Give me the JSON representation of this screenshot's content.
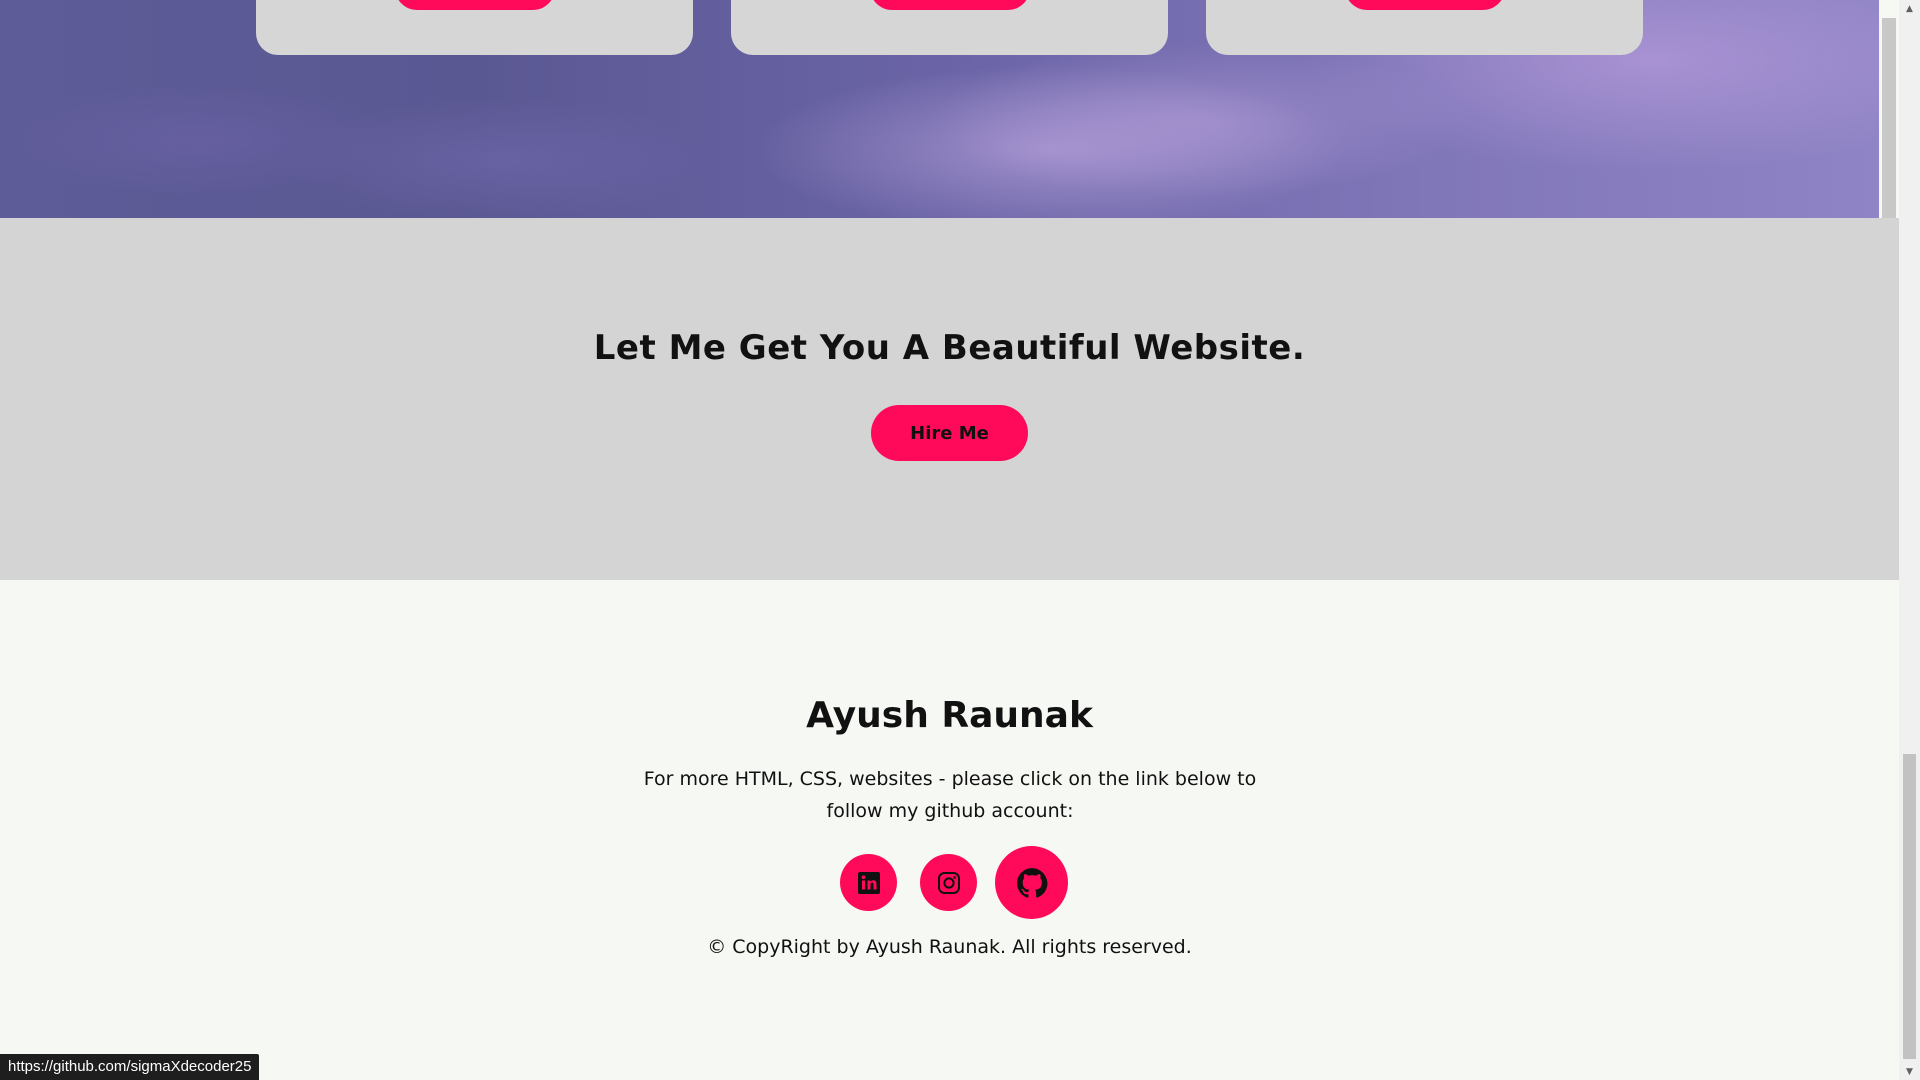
{
  "hero": {
    "cards": [
      {
        "name": "service-card-1"
      },
      {
        "name": "service-card-2"
      },
      {
        "name": "service-card-3"
      }
    ]
  },
  "cta": {
    "title": "Let Me Get You A Beautiful Website.",
    "button_label": "Hire Me"
  },
  "footer": {
    "name": "Ayush Raunak",
    "description": "For more HTML, CSS, websites - please click on the link below to follow my github account:",
    "socials": [
      {
        "icon": "linkedin-icon"
      },
      {
        "icon": "instagram-icon"
      },
      {
        "icon": "github-icon"
      }
    ],
    "copyright": "© CopyRight by Ayush Raunak. All rights reserved."
  },
  "status_bar": {
    "url": "https://github.com/sigmaXdecoder25"
  },
  "colors": {
    "accent": "#ff0a5a",
    "cta_bg": "#d4d4d4",
    "footer_bg": "#f6f8f3",
    "text": "#111111"
  }
}
